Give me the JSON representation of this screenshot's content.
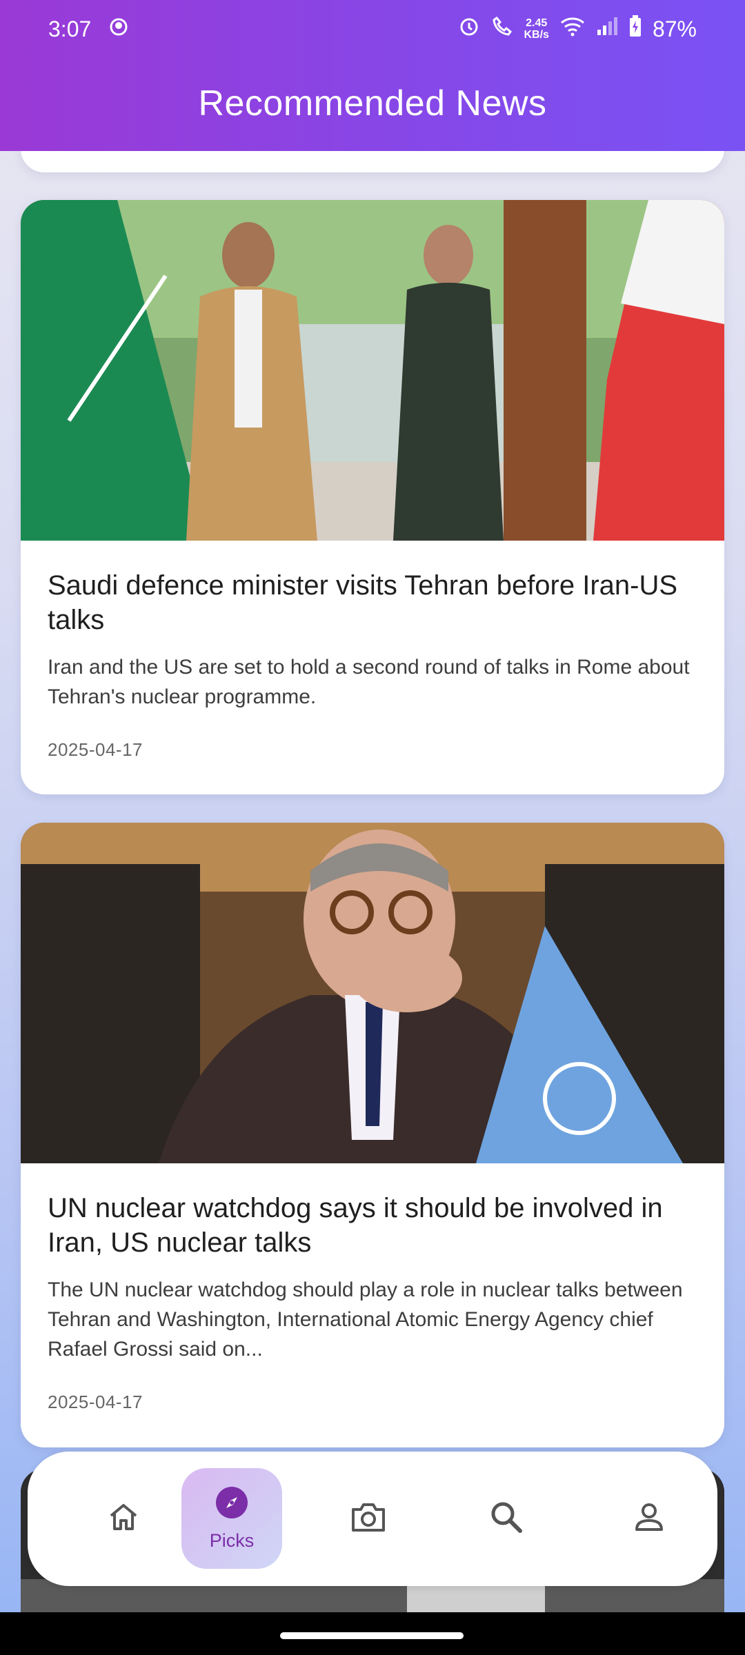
{
  "status_bar": {
    "time": "3:07",
    "speed_value": "2.45",
    "speed_unit": "KB/s",
    "battery": "87%"
  },
  "header": {
    "title": "Recommended News"
  },
  "articles": [
    {
      "headline": "Saudi defence minister visits Tehran before Iran-US talks",
      "summary": "Iran and the US are set to hold a second round of talks in Rome about Tehran's nuclear programme.",
      "date": "2025-04-17"
    },
    {
      "headline": "UN nuclear watchdog says it should be involved in Iran, US nuclear talks",
      "summary": "The UN nuclear watchdog should play a role in nuclear talks between Tehran and Washington, International Atomic Energy Agency chief Rafael Grossi said on...",
      "date": "2025-04-17"
    }
  ],
  "nav": {
    "items": [
      {
        "icon": "home-icon"
      },
      {
        "icon": "compass-icon",
        "label": "Picks",
        "active": true
      },
      {
        "icon": "camera-icon"
      },
      {
        "icon": "search-icon"
      },
      {
        "icon": "profile-icon"
      }
    ]
  },
  "colors": {
    "header_start": "#9a39d6",
    "header_end": "#7a52f4",
    "accent": "#7b2ea8"
  }
}
